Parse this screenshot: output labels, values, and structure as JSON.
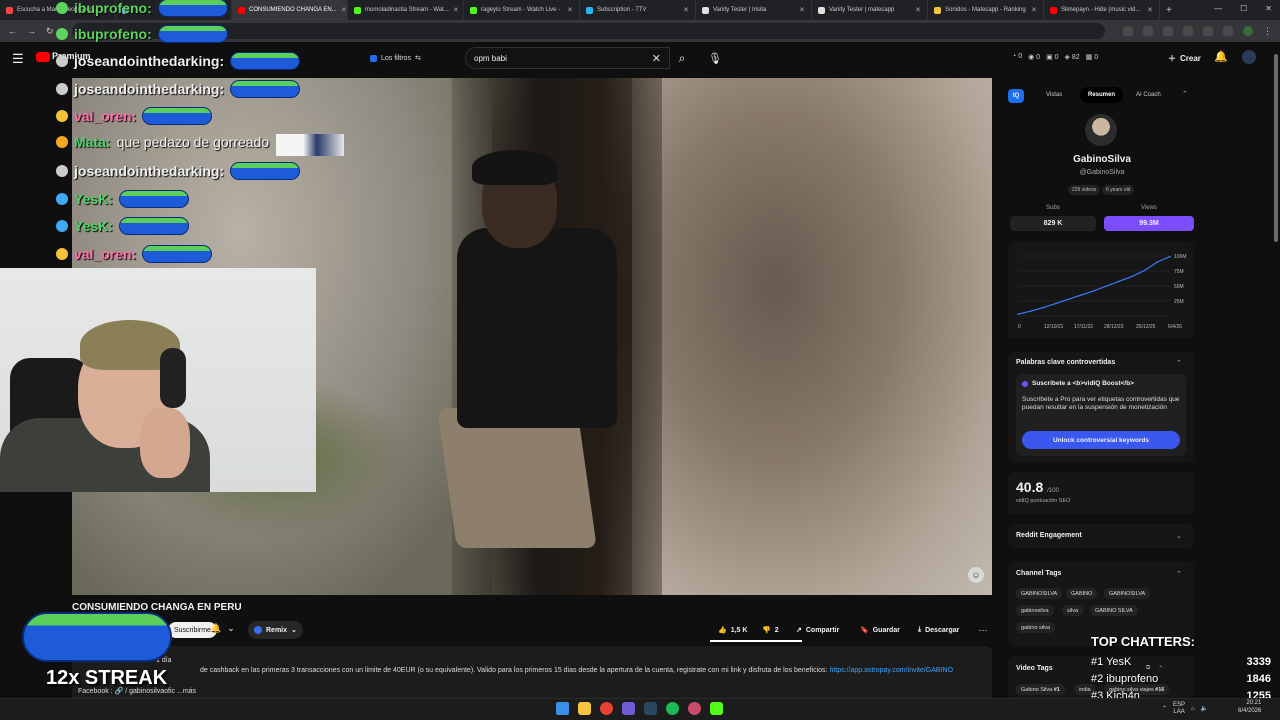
{
  "tabs": [
    {
      "label": "Escucha a María Becerra en...",
      "color": "#ff4444",
      "active": false
    },
    {
      "label": "",
      "color": "#8ab4f8",
      "active": false
    },
    {
      "label": "CONSUMIENDO CHANGA EN...",
      "color": "#ff0000",
      "active": true
    },
    {
      "label": "momoladinastia Stream - Wat...",
      "color": "#53fc18",
      "active": false
    },
    {
      "label": "rageylo Stream - Watch Live -",
      "color": "#53fc18",
      "active": false
    },
    {
      "label": "Subscription - 7TV",
      "color": "#29b6f6",
      "active": false
    },
    {
      "label": "Vanity Tester | Irisita",
      "color": "#e0e0e0",
      "active": false
    },
    {
      "label": "Vanity Tester | matecapp",
      "color": "#e0e0e0",
      "active": false
    },
    {
      "label": "Sonidos - Matecapp - Ranking",
      "color": "#f4c542",
      "active": false
    },
    {
      "label": "Slimepayn - Hide (music vid...",
      "color": "#ff0000",
      "active": false
    }
  ],
  "window_controls": {
    "minimize": "—",
    "maximize": "☐",
    "close": "✕"
  },
  "header": {
    "logo_text": "Premium",
    "filters_label": "Los filtros",
    "search_value": "opm babi",
    "stats": [
      "0",
      "0",
      "0",
      "82",
      "0"
    ],
    "create_label": "Crear"
  },
  "chat": [
    {
      "user": "ibuprofeno:",
      "color": "#5fd35f",
      "badge": "#5fd35f",
      "text": "",
      "y": 8
    },
    {
      "user": "ibuprofeno:",
      "color": "#5fd35f",
      "badge": "#5fd35f",
      "text": "",
      "y": 34
    },
    {
      "user": "joseandointhedarking:",
      "color": "#f0f0f0",
      "badge": "#cccccc",
      "text": "",
      "y": 61
    },
    {
      "user": "joseandointhedarking:",
      "color": "#f0f0f0",
      "badge": "#cccccc",
      "text": "",
      "y": 89
    },
    {
      "user": "val_oren:",
      "color": "#ff6fa8",
      "badge": "#f5c33a",
      "text": "",
      "y": 116
    },
    {
      "user": "Mata:",
      "color": "#4fd36b",
      "badge": "#f5a623",
      "text": "que pedazo de gorreado",
      "y": 143
    },
    {
      "user": "joseandointhedarking:",
      "color": "#f0f0f0",
      "badge": "#cccccc",
      "text": "",
      "y": 171
    },
    {
      "user": "YesK:",
      "color": "#4fd36b",
      "badge": "#3fa9f5",
      "text": "",
      "y": 199
    },
    {
      "user": "YesK:",
      "color": "#4fd36b",
      "badge": "#3fa9f5",
      "text": "",
      "y": 226
    },
    {
      "user": "val_oren:",
      "color": "#ff6fa8",
      "badge": "#f5c33a",
      "text": "",
      "y": 254
    }
  ],
  "video": {
    "title": "CONSUMIENDO CHANGA EN PERU",
    "subscribe_label": "Suscribirme",
    "remix_label": "Remix",
    "like_count": "1,5 K",
    "dislike_count": "2",
    "share_label": "Compartir",
    "save_label": "Guardar",
    "download_label": "Descargar",
    "desc_date": "1 día",
    "desc_text": "de cashback en las primeras 3 transacciones con un limite de 40EUR (o su equivalente). Valido para los primeros 15 dias desde la apertura de la cuenta, registrate con mi link y disfruta de los beneficios:",
    "desc_link": "https://app.astropay.com/invite/GABINO",
    "desc_fb": "Facebook : 🔗 / gabinosilvaofic  ...más"
  },
  "overlay": {
    "streak": "12x STREAK",
    "top_chatters_title": "TOP CHATTERS:",
    "top_chatters": [
      {
        "rank": "#1 YesK",
        "score": "3339"
      },
      {
        "rank": "#2 ibuprofeno",
        "score": "1846"
      },
      {
        "rank": "#3 Kich4n",
        "score": "1255"
      }
    ]
  },
  "vidiq": {
    "logo": "IQ",
    "tabs": [
      "Vistas",
      "Resumen",
      "AI Coach"
    ],
    "active_tab": "Resumen",
    "channel_name": "GabinoSilva",
    "channel_handle": "@GabinoSilva",
    "video_count": "229 videos",
    "age": "6 years old",
    "subs_label": "Subs",
    "views_label": "Views",
    "subs_value": "829 K",
    "views_value": "99.3M",
    "keywords_title": "Palabras clave controvertidas",
    "keywords_promo": "Suscríbete a <b>vidIQ Boost</b>",
    "keywords_desc": "Suscríbete a Pro para ver etiquetas controvertidas que puedan resultar en la suspensión de monetización",
    "keywords_button": "Unlock controversial keywords",
    "seo_score": "40.8",
    "seo_max": "/100",
    "seo_label": "vidIQ puntuación SEO",
    "reddit_title": "Reddit Engagement",
    "tags_title": "Channel Tags",
    "tags": [
      "GABINOSILVA",
      "GABINO",
      "GABINOSILVA",
      "gabinosilva",
      "silva",
      "GABINO SILVA",
      "gabino silva"
    ],
    "video_tags_title": "Video Tags",
    "video_tags": [
      "Gabino Silva",
      "#1",
      "india",
      "gabino silva viajes",
      "#16"
    ]
  },
  "chart_data": {
    "type": "line",
    "title": "",
    "x_tick_labels": [
      "0",
      "12/10/21",
      "17/11/22",
      "28/12/23",
      "25/12/25",
      "6/4/26"
    ],
    "y_tick_labels": [
      "0",
      "25M",
      "50M",
      "75M",
      "100M"
    ],
    "ylim": [
      0,
      100
    ],
    "series": [
      {
        "values": [
          3,
          8,
          14,
          21,
          28,
          35,
          42,
          50,
          58,
          66,
          76,
          90,
          99
        ]
      }
    ],
    "grid": true
  },
  "taskbar": {
    "apps": [
      {
        "name": "windows-start-icon",
        "color": "#3a8ee6"
      },
      {
        "name": "file-explorer-icon",
        "color": "#f4c542"
      },
      {
        "name": "chrome-icon",
        "color": "#e94235"
      },
      {
        "name": "obs-icon",
        "color": "#6d5cd3"
      },
      {
        "name": "steam-icon",
        "color": "#2a475e"
      },
      {
        "name": "spotify-icon",
        "color": "#1db954"
      },
      {
        "name": "app-icon",
        "color": "#c94a6b"
      },
      {
        "name": "kick-icon",
        "color": "#53fc18"
      }
    ],
    "lang": "ESP",
    "lang2": "LAA",
    "time": "20:21",
    "date": "6/4/2026"
  }
}
